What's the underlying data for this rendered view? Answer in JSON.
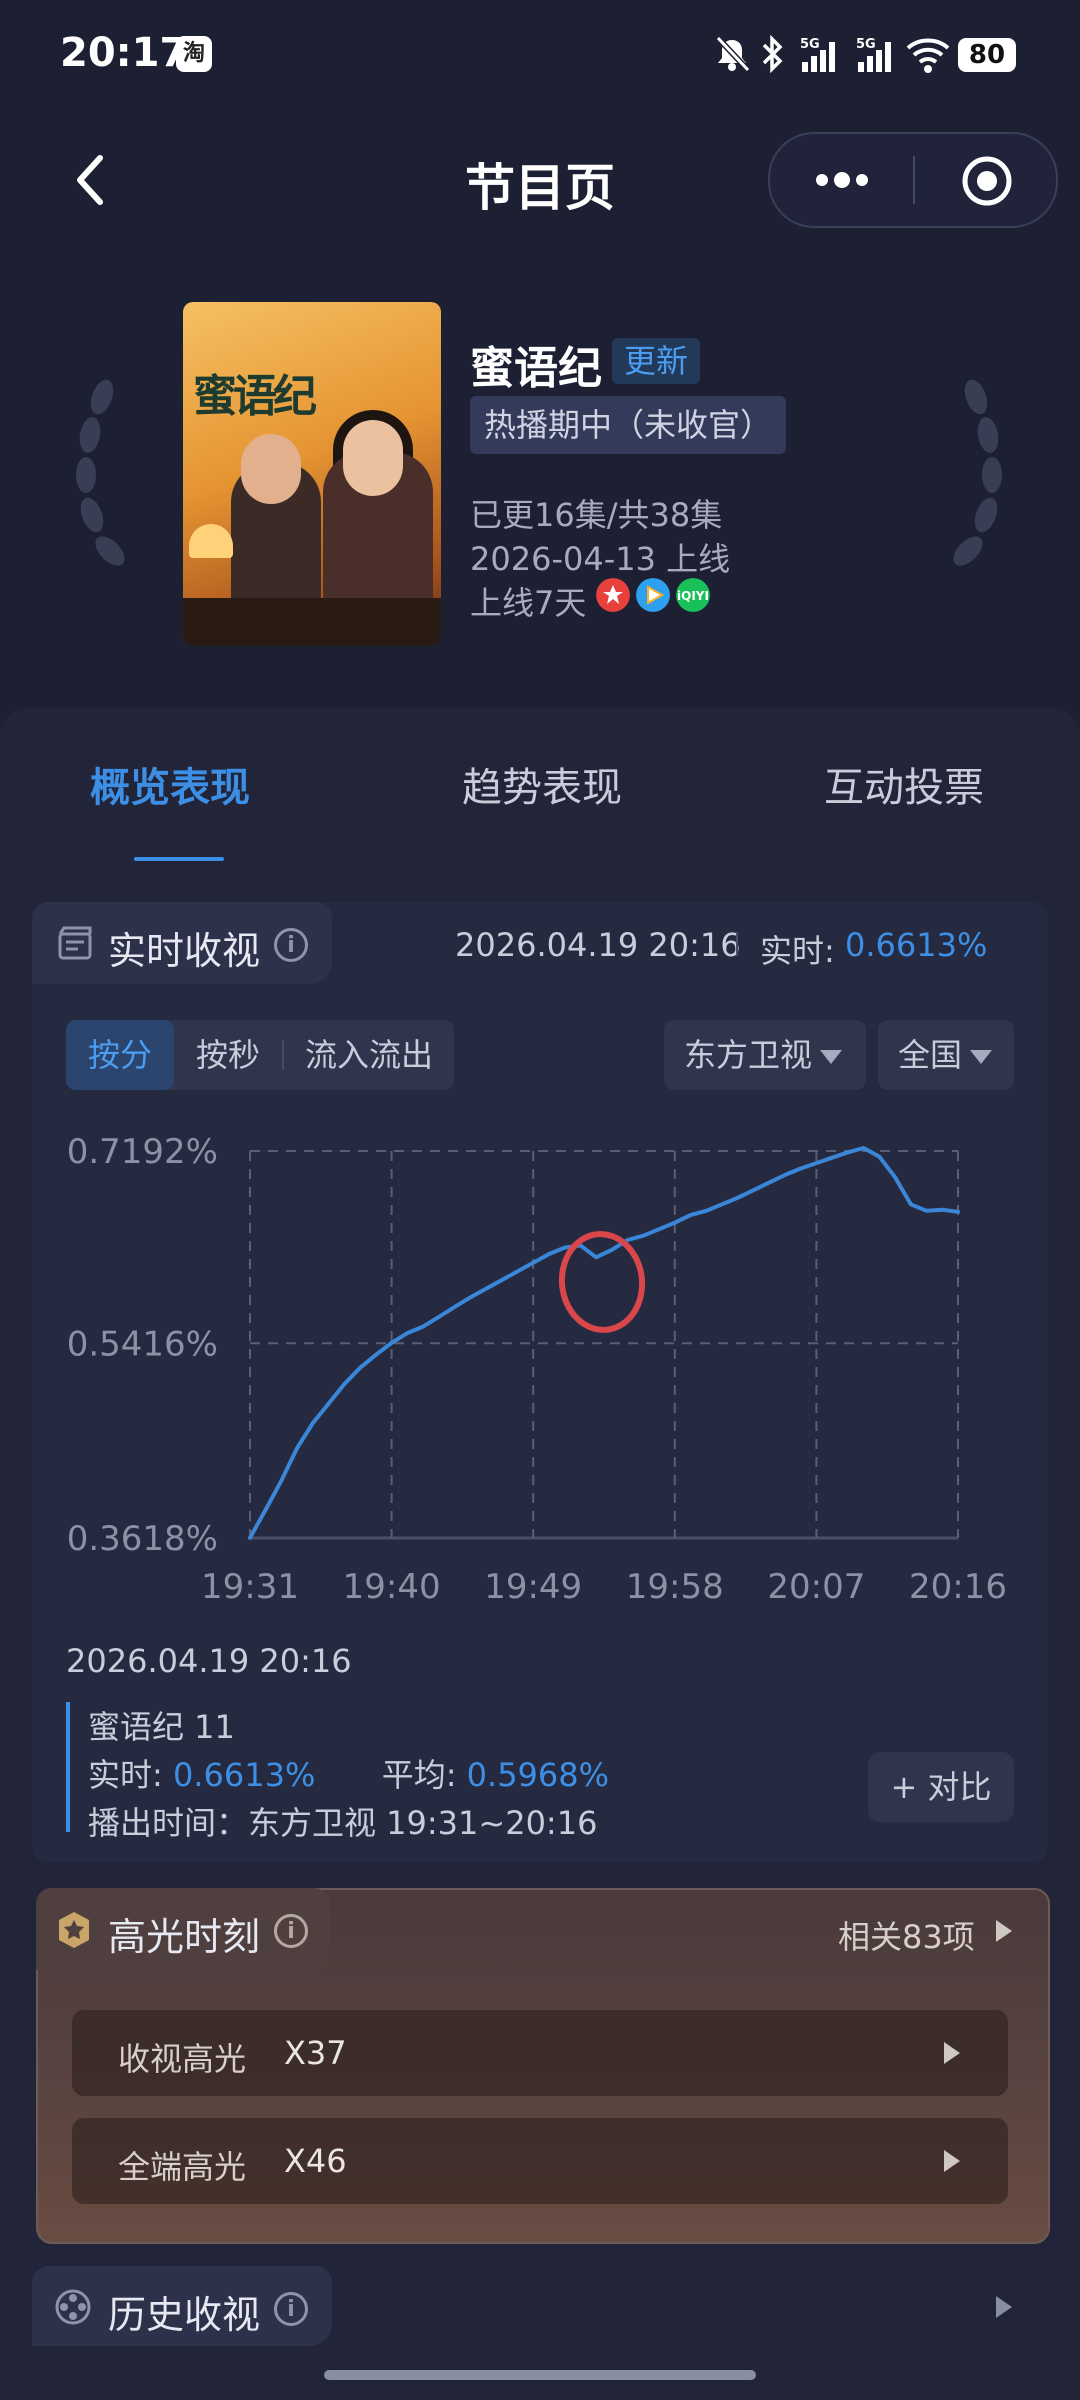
{
  "status_bar": {
    "time": "20:17",
    "app_badge": "淘",
    "icons": [
      "mute-icon",
      "bluetooth-icon",
      "signal-5g-icon",
      "signal-5g-icon",
      "wifi-icon"
    ],
    "battery": "80"
  },
  "nav": {
    "title": "节目页",
    "icons": [
      "back-icon",
      "more-icon",
      "target-icon"
    ]
  },
  "show": {
    "title": "蜜语纪",
    "update_badge": "更新",
    "status_tag": "热播期中（未收官）",
    "episodes": "已更16集/共38集",
    "release": "2026-04-13 上线",
    "days_online": "上线7天",
    "poster_title": "蜜语纪",
    "platforms": [
      {
        "name": "mango-tv-icon",
        "color": "#e8403d"
      },
      {
        "name": "tencent-video-icon",
        "color": "#2ea0f0"
      },
      {
        "name": "iqiyi-icon",
        "color": "#19c05a"
      }
    ]
  },
  "tabs": [
    {
      "label": "概览表现",
      "active": true
    },
    {
      "label": "趋势表现",
      "active": false
    },
    {
      "label": "互动投票",
      "active": false
    }
  ],
  "realtime": {
    "title": "实时收视",
    "timestamp": "2026.04.19 20:16",
    "rt_label": "实时:",
    "rt_value": "0.6613%",
    "segments": [
      "按分",
      "按秒",
      "流入流出"
    ],
    "channel": "东方卫视",
    "region": "全国"
  },
  "chart_data": {
    "type": "line",
    "x_ticks": [
      "19:31",
      "19:40",
      "19:49",
      "19:58",
      "20:07",
      "20:16"
    ],
    "y_ticks": [
      "0.7192%",
      "0.5416%",
      "0.3618%"
    ],
    "ylim": [
      0.3618,
      0.7192
    ],
    "xlim_minutes": [
      0,
      45
    ],
    "grid": true,
    "line_color": "#3a86d8",
    "series": [
      {
        "x": [
          0,
          1,
          2,
          3,
          4,
          5,
          6,
          7,
          8,
          9,
          10,
          11,
          12,
          13,
          14,
          15,
          16,
          17,
          18,
          19,
          20,
          21,
          22,
          23,
          24,
          25,
          26,
          27,
          28,
          29,
          30,
          31,
          32,
          33,
          34,
          35,
          36,
          37,
          38,
          39,
          40,
          41,
          42,
          43,
          44,
          45
        ],
        "y": [
          0.362,
          0.388,
          0.415,
          0.445,
          0.468,
          0.486,
          0.504,
          0.519,
          0.531,
          0.542,
          0.551,
          0.557,
          0.566,
          0.575,
          0.584,
          0.592,
          0.6,
          0.608,
          0.616,
          0.624,
          0.63,
          0.632,
          0.621,
          0.628,
          0.637,
          0.641,
          0.647,
          0.653,
          0.66,
          0.664,
          0.67,
          0.676,
          0.683,
          0.69,
          0.697,
          0.703,
          0.708,
          0.713,
          0.718,
          0.722,
          0.714,
          0.695,
          0.67,
          0.664,
          0.665,
          0.663
        ]
      }
    ]
  },
  "tooltip": {
    "date": "2026.04.19 20:16",
    "episode": "蜜语纪 11",
    "rt_label": "实时:",
    "rt_value": "0.6613%",
    "avg_label": "平均:",
    "avg_value": "0.5968%",
    "airtime": "播出时间：东方卫视 19:31~20:16",
    "compare_button": "+ 对比"
  },
  "highlights": {
    "title": "高光时刻",
    "related": "相关83项",
    "rows": [
      {
        "label": "收视高光",
        "value": "X37"
      },
      {
        "label": "全端高光",
        "value": "X46"
      }
    ]
  },
  "history": {
    "title": "历史收视"
  }
}
